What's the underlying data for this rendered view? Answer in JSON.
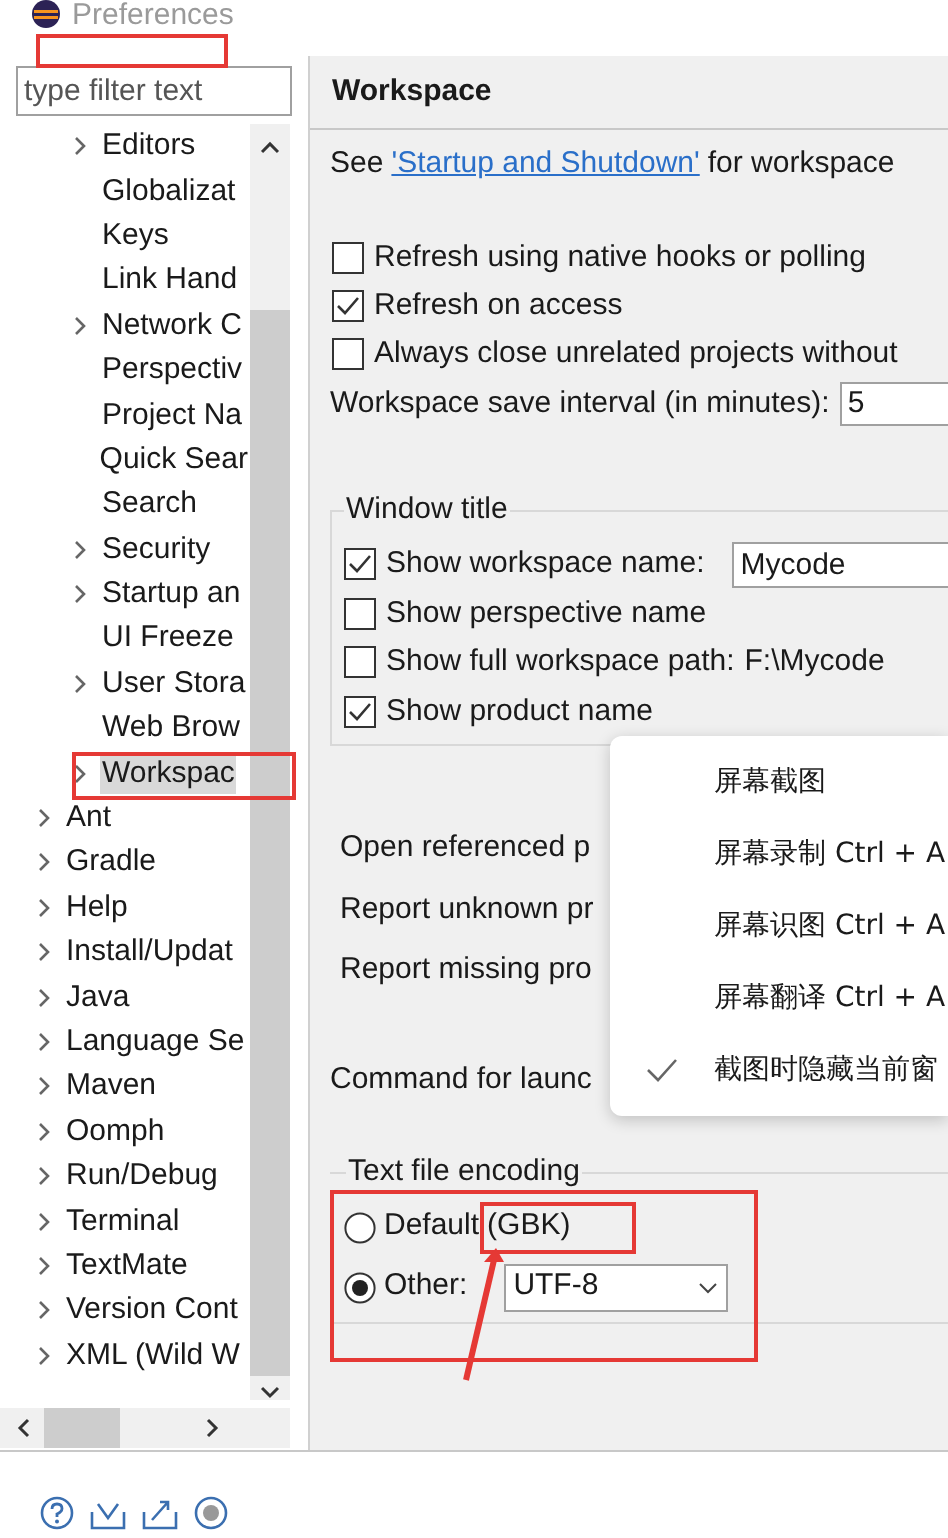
{
  "window": {
    "title": "Preferences"
  },
  "filter": {
    "placeholder": "type filter text"
  },
  "tree": {
    "items": [
      {
        "children": [
          {
            "label": "Editors",
            "expandable": true,
            "selected": false
          },
          {
            "label": "Globalizat",
            "expandable": false,
            "selected": false
          },
          {
            "label": "Keys",
            "expandable": false,
            "selected": false
          },
          {
            "label": "Link Hand",
            "expandable": false,
            "selected": false
          },
          {
            "label": "Network C",
            "expandable": true,
            "selected": false
          },
          {
            "label": "Perspectiv",
            "expandable": false,
            "selected": false
          },
          {
            "label": "Project Na",
            "expandable": false,
            "selected": false
          },
          {
            "label": "Quick Sear",
            "expandable": false,
            "selected": false
          },
          {
            "label": "Search",
            "expandable": false,
            "selected": false
          },
          {
            "label": "Security",
            "expandable": true,
            "selected": false
          },
          {
            "label": "Startup an",
            "expandable": true,
            "selected": false
          },
          {
            "label": "UI Freeze",
            "expandable": false,
            "selected": false
          },
          {
            "label": "User Stora",
            "expandable": true,
            "selected": false
          },
          {
            "label": "Web Brow",
            "expandable": false,
            "selected": false
          },
          {
            "label": "Workspac",
            "expandable": true,
            "selected": true
          }
        ]
      },
      {
        "label": "Ant",
        "expandable": true,
        "selected": false
      },
      {
        "label": "Gradle",
        "expandable": true,
        "selected": false
      },
      {
        "label": "Help",
        "expandable": true,
        "selected": false
      },
      {
        "label": "Install/Updat",
        "expandable": true,
        "selected": false
      },
      {
        "label": "Java",
        "expandable": true,
        "selected": false
      },
      {
        "label": "Language Se",
        "expandable": true,
        "selected": false
      },
      {
        "label": "Maven",
        "expandable": true,
        "selected": false
      },
      {
        "label": "Oomph",
        "expandable": true,
        "selected": false
      },
      {
        "label": "Run/Debug",
        "expandable": true,
        "selected": false
      },
      {
        "label": "Terminal",
        "expandable": true,
        "selected": false
      },
      {
        "label": "TextMate",
        "expandable": true,
        "selected": false
      },
      {
        "label": "Version Cont",
        "expandable": true,
        "selected": false
      },
      {
        "label": "XML (Wild W",
        "expandable": true,
        "selected": false
      }
    ]
  },
  "page": {
    "title": "Workspace",
    "intro": {
      "before": "See",
      "link": "'Startup and Shutdown'",
      "after": "for workspace"
    },
    "options": [
      {
        "label": "Refresh using native hooks or polling",
        "checked": false
      },
      {
        "label": "Refresh on access",
        "checked": true
      },
      {
        "label": "Always close unrelated projects without",
        "checked": false
      }
    ],
    "save_interval": {
      "label": "Workspace save interval (in minutes):",
      "value": "5"
    },
    "window_title": {
      "label": "Window title",
      "options": [
        {
          "label": "Show workspace name:",
          "checked": true,
          "value": "Mycode"
        },
        {
          "label": "Show perspective name",
          "checked": false
        },
        {
          "label": "Show full workspace path:",
          "checked": false,
          "value": "F:\\Mycode"
        },
        {
          "label": "Show product name",
          "checked": true
        }
      ]
    },
    "settings": [
      "Open referenced p",
      "Report unknown pr",
      "Report missing pro"
    ],
    "command": "Command for launc",
    "encoding": {
      "label": "Text file encoding",
      "options": [
        {
          "label": "Default",
          "note": "(GBK)",
          "selected": false
        },
        {
          "label": "Other:",
          "value": "UTF-8",
          "selected": true
        }
      ]
    }
  },
  "context_menu": {
    "items": [
      {
        "label": "屏幕截图",
        "checked": false
      },
      {
        "label": "屏幕录制 Ctrl + A",
        "checked": false
      },
      {
        "label": "屏幕识图 Ctrl + A",
        "checked": false
      },
      {
        "label": "屏幕翻译 Ctrl + A",
        "checked": false
      },
      {
        "label": "截图时隐藏当前窗",
        "checked": true
      }
    ]
  }
}
